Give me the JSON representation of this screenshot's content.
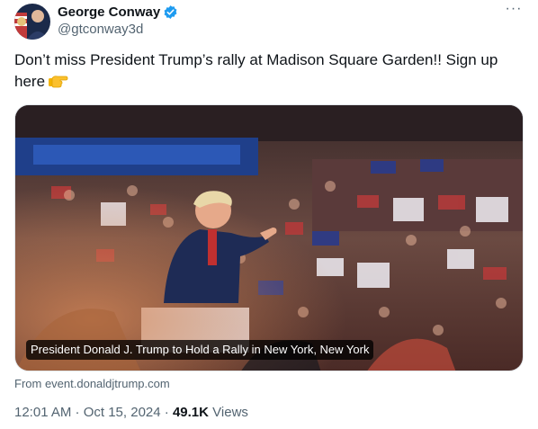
{
  "author": {
    "display_name": "George Conway",
    "handle": "@gtconway3d",
    "verified": true
  },
  "tweet": {
    "text": "Don’t miss President Trump’s rally at Madison Square Garden!!  Sign up here",
    "emoji": "backhand-index-pointing-right"
  },
  "card": {
    "caption": "President Donald J. Trump to Hold a Rally in New York, New York",
    "source": "From event.donaldjtrump.com"
  },
  "meta": {
    "timestamp": "12:01 AM · Oct 15, 2024",
    "separator": " · ",
    "views_count": "49.1K",
    "views_label": "Views"
  },
  "menu": {
    "more_glyph": "···"
  },
  "colors": {
    "accent": "#1d9bf0",
    "secondary_text": "#536471",
    "primary_text": "#0f1419"
  }
}
